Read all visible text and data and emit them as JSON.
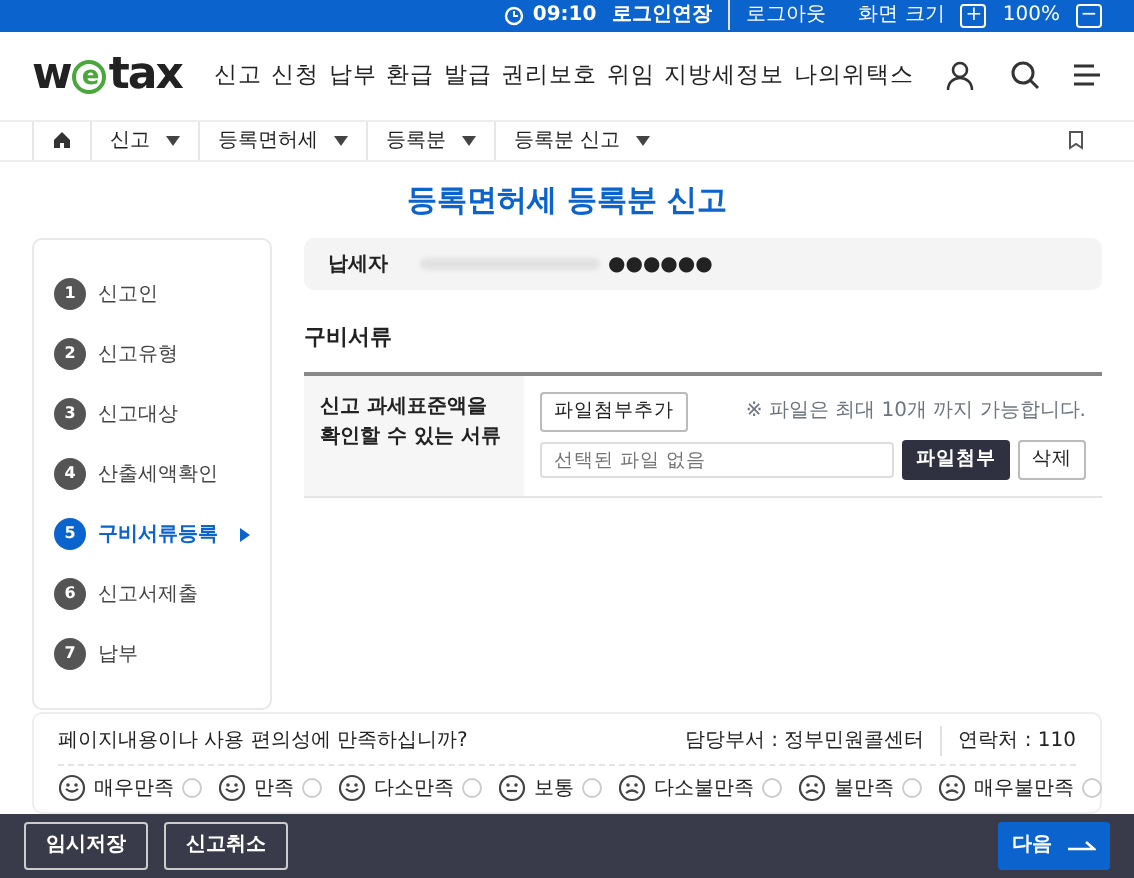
{
  "top_bar": {
    "session_time": "09:10",
    "extend_label": "로그인연장",
    "logout": "로그아웃",
    "zoom_label": "화면 크기",
    "zoom_in": "+",
    "zoom_level": "100%",
    "zoom_out": "−"
  },
  "header": {
    "logo": "wetax",
    "nav": [
      "신고",
      "신청",
      "납부",
      "환급",
      "발급",
      "권리보호",
      "위임",
      "지방세정보",
      "나의위택스"
    ]
  },
  "breadcrumb": [
    "신고",
    "등록면허세",
    "등록분",
    "등록분 신고"
  ],
  "page_title": "등록면허세 등록분 신고",
  "steps": [
    {
      "number": "1",
      "label": "신고인",
      "selected": false
    },
    {
      "number": "2",
      "label": "신고유형",
      "selected": false
    },
    {
      "number": "3",
      "label": "신고대상",
      "selected": false
    },
    {
      "number": "4",
      "label": "산출세액확인",
      "selected": false
    },
    {
      "number": "5",
      "label": "구비서류등록",
      "selected": true
    },
    {
      "number": "6",
      "label": "신고서제출",
      "selected": false
    },
    {
      "number": "7",
      "label": "납부",
      "selected": false
    }
  ],
  "taxpayer": {
    "label": "납세자",
    "value": "●●●●●●"
  },
  "documents": {
    "heading": "구비서류",
    "row_label": "신고 과세표준액을 확인할 수 있는 서류",
    "add_button": "파일첨부추가",
    "note": "※ 파일은 최대 10개 까지 가능합니다.",
    "file_field": {
      "placeholder": "선택된 파일 없음"
    },
    "attach_button": "파일첨부",
    "delete_button": "삭제"
  },
  "feedback": {
    "question": "페이지내용이나 사용 편의성에 만족하십니까?",
    "department": "담당부서 : 정부민원콜센터",
    "contact": "연락처 : 110",
    "options": [
      {
        "label": "매우만족",
        "selected": false
      },
      {
        "label": "만족",
        "selected": false
      },
      {
        "label": "다소만족",
        "selected": false
      },
      {
        "label": "보통",
        "selected": false
      },
      {
        "label": "다소불만족",
        "selected": false
      },
      {
        "label": "불만족",
        "selected": false
      },
      {
        "label": "매우불만족",
        "selected": false
      }
    ]
  },
  "footer": {
    "buttons": [
      {
        "label": "임시저장",
        "kind": "outline"
      },
      {
        "label": "신고취소",
        "kind": "outline"
      },
      {
        "label": "다음",
        "kind": "primary"
      }
    ]
  }
}
